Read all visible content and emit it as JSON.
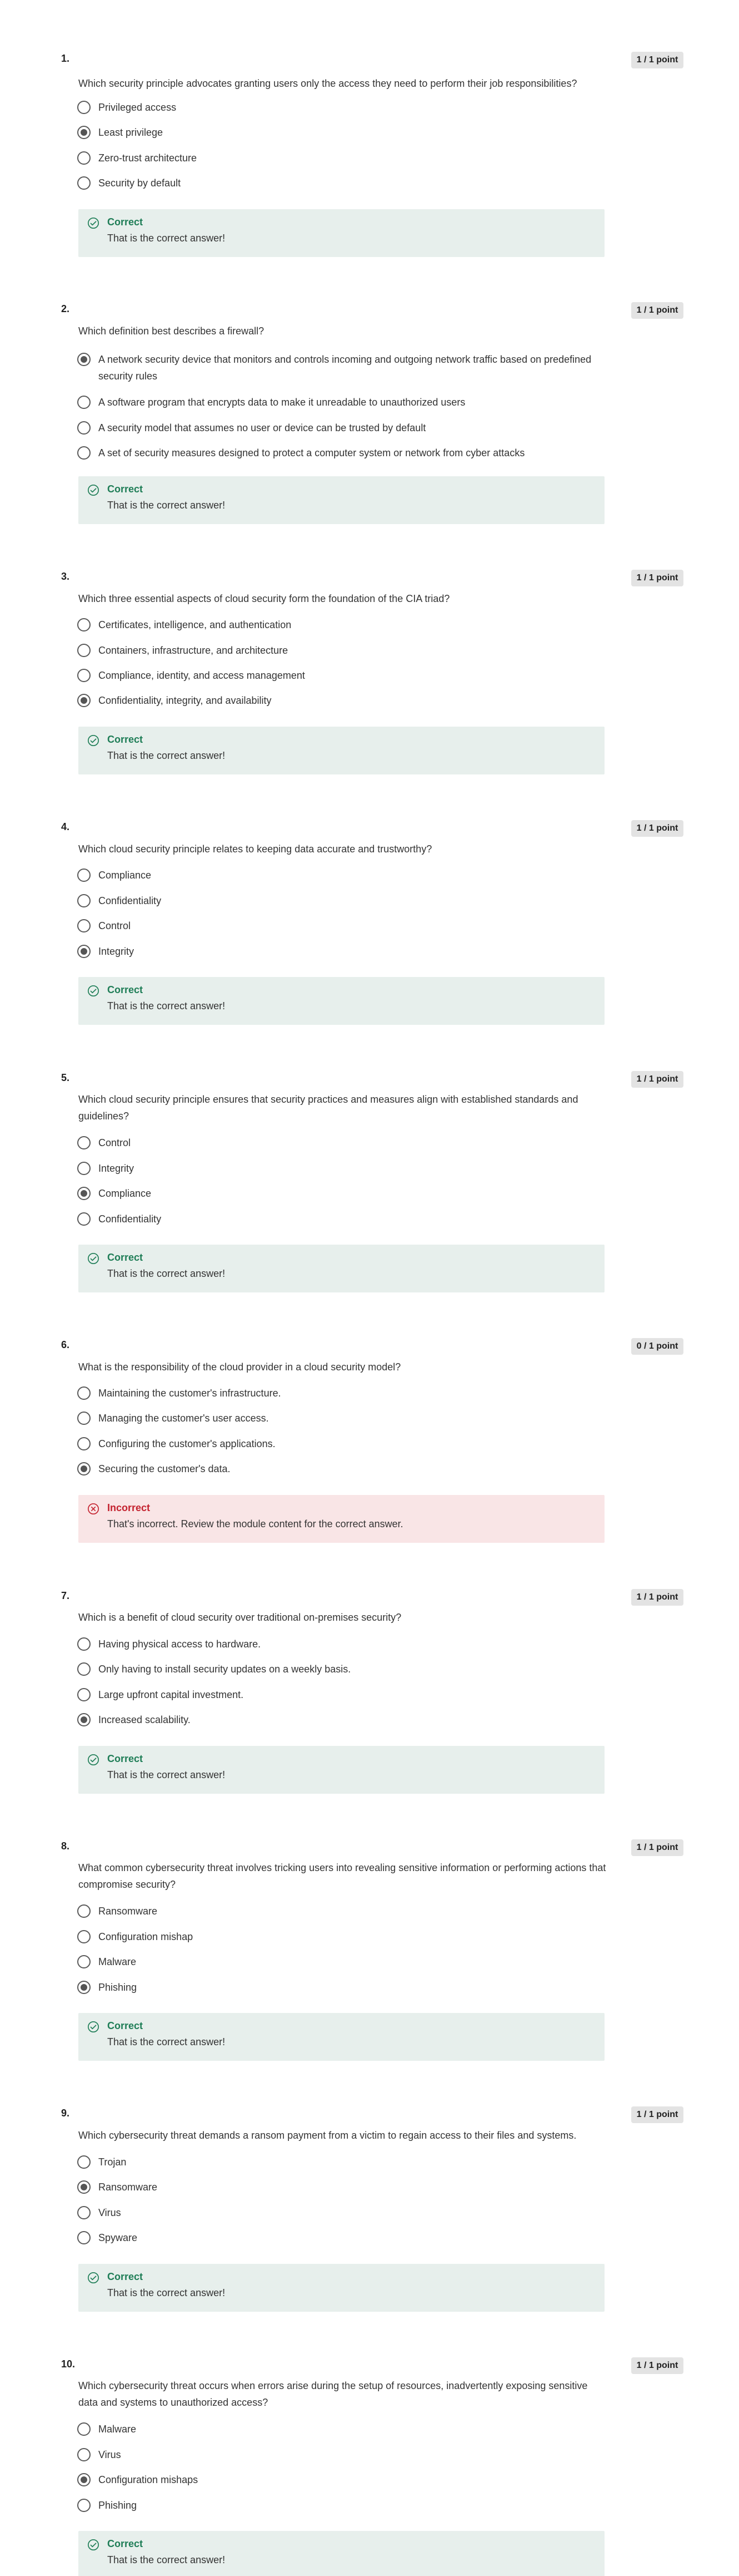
{
  "feedback_labels": {
    "correct_title": "Correct",
    "correct_text": "That is the correct answer!",
    "incorrect_title": "Incorrect",
    "incorrect_text": "That's incorrect. Review the module content for the correct answer."
  },
  "questions": [
    {
      "number": "1.",
      "points": "1 / 1 point",
      "text": "Which security principle advocates granting users only the access they need to perform their job responsibilities?",
      "options": [
        "Privileged access",
        "Least privilege",
        "Zero-trust architecture",
        "Security by default"
      ],
      "selected_index": 1,
      "result": "correct"
    },
    {
      "number": "2.",
      "points": "1 / 1 point",
      "text": "Which definition best describes a firewall?",
      "options": [
        "A network security device that monitors and controls incoming and outgoing network traffic based on predefined security rules",
        "A software program that encrypts data to make it unreadable to unauthorized users",
        "A security model that assumes no user or device can be trusted by default",
        "A set of security measures designed to protect a computer system or network from cyber attacks"
      ],
      "selected_index": 0,
      "result": "correct"
    },
    {
      "number": "3.",
      "points": "1 / 1 point",
      "text": "Which three essential aspects of cloud security form the foundation of the CIA triad?",
      "options": [
        "Certificates, intelligence, and authentication",
        "Containers, infrastructure, and architecture",
        "Compliance, identity, and access management",
        "Confidentiality, integrity, and availability"
      ],
      "selected_index": 3,
      "result": "correct"
    },
    {
      "number": "4.",
      "points": "1 / 1 point",
      "text": "Which cloud security principle relates to keeping data accurate and trustworthy?",
      "options": [
        "Compliance",
        "Confidentiality",
        "Control",
        "Integrity"
      ],
      "selected_index": 3,
      "result": "correct"
    },
    {
      "number": "5.",
      "points": "1 / 1 point",
      "text": "Which cloud security principle ensures that security practices and measures align with established standards and guidelines?",
      "options": [
        "Control",
        "Integrity",
        "Compliance",
        "Confidentiality"
      ],
      "selected_index": 2,
      "result": "correct"
    },
    {
      "number": "6.",
      "points": "0 / 1 point",
      "text": "What is the responsibility of the cloud provider in a cloud security model?",
      "options": [
        "Maintaining the customer's infrastructure.",
        "Managing the customer's user access.",
        "Configuring the customer's applications.",
        "Securing the customer's data."
      ],
      "selected_index": 3,
      "result": "incorrect"
    },
    {
      "number": "7.",
      "points": "1 / 1 point",
      "text": "Which is a benefit of cloud security over traditional on-premises security?",
      "options": [
        "Having physical access to hardware.",
        "Only having to install security updates on a weekly basis.",
        "Large upfront capital investment.",
        "Increased scalability."
      ],
      "selected_index": 3,
      "result": "correct"
    },
    {
      "number": "8.",
      "points": "1 / 1 point",
      "text": "What common cybersecurity threat involves tricking users into revealing sensitive information or performing actions that compromise security?",
      "options": [
        "Ransomware",
        "Configuration mishap",
        "Malware",
        "Phishing"
      ],
      "selected_index": 3,
      "result": "correct"
    },
    {
      "number": "9.",
      "points": "1 / 1 point",
      "text": "Which cybersecurity threat demands a ransom payment from a victim to regain access to their files and systems.",
      "options": [
        "Trojan",
        "Ransomware",
        "Virus",
        "Spyware"
      ],
      "selected_index": 1,
      "result": "correct"
    },
    {
      "number": "10.",
      "points": "1 / 1 point",
      "text": "Which cybersecurity threat occurs when errors arise during the setup of resources, inadvertently exposing sensitive data and systems to unauthorized access?",
      "options": [
        "Malware",
        "Virus",
        "Configuration mishaps",
        "Phishing"
      ],
      "selected_index": 2,
      "result": "correct"
    }
  ]
}
